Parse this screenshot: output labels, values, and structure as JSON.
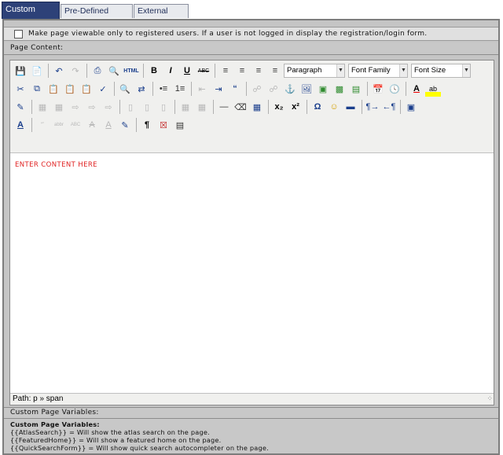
{
  "tabs": [
    {
      "label": "Custom Page",
      "active": true
    },
    {
      "label": "Pre-Defined Page",
      "active": false
    },
    {
      "label": "External Link",
      "active": false
    }
  ],
  "registration": {
    "checked": false,
    "label": "Make page viewable only to registered users. If a user is not logged in display the registration/login form."
  },
  "page_content_label": "Page Content:",
  "toolbar": {
    "format_select": "Paragraph",
    "font_family_select": "Font Family",
    "font_size_select": "Font Size",
    "html_button": "HTML"
  },
  "editor": {
    "content": "ENTER CONTENT HERE",
    "path": "Path: p » span"
  },
  "variables": {
    "section_label": "Custom Page Variables:",
    "title": "Custom Page Variables:",
    "lines": [
      "{{AtlasSearch}} = Will show the atlas search on the page.",
      "{{FeaturedHome}} = Will show a featured home on the page.",
      "{{QuickSearchForm}} = Will show quick search autocompleter on the page."
    ]
  },
  "colors": {
    "active_tab": "#2d4178",
    "content_text": "#e02020",
    "panel_bg": "#c5c5c5"
  }
}
